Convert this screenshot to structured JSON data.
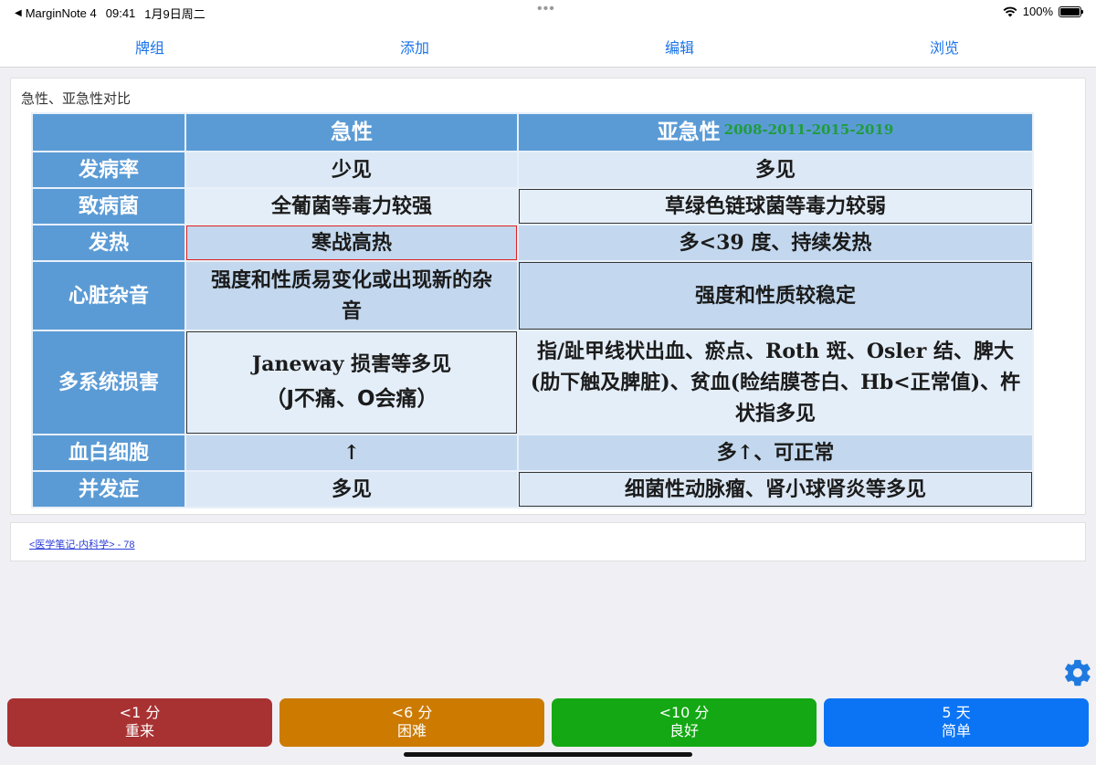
{
  "status_bar": {
    "back_app": "MarginNote 4",
    "time": "09:41",
    "date": "1月9日周二",
    "battery": "100%"
  },
  "nav": {
    "deck": "牌组",
    "add": "添加",
    "edit": "编辑",
    "browse": "浏览"
  },
  "card": {
    "title": "急性、亚急性对比",
    "table": {
      "col_acute": "急性",
      "col_subacute": "亚急性",
      "years": "2008-2011-2015-2019",
      "rows": [
        {
          "label": "发病率",
          "acute": "少见",
          "subacute": "多见"
        },
        {
          "label": "致病菌",
          "acute": "全葡菌等毒力较强",
          "subacute": "草绿色链球菌等毒力较弱"
        },
        {
          "label": "发热",
          "acute": "寒战高热",
          "subacute": "多<39 度、持续发热"
        },
        {
          "label": "心脏杂音",
          "acute": "强度和性质易变化或出现新的杂音",
          "subacute": "强度和性质较稳定"
        },
        {
          "label": "多系统损害",
          "acute": "Janeway 损害等多见",
          "acute_note": "（J不痛、O会痛）",
          "subacute": "指/趾甲线状出血、瘀点、Roth 斑、Osler 结、脾大(肋下触及脾脏)、贫血(睑结膜苍白、Hb<正常值)、杵状指多见"
        },
        {
          "label": "血白细胞",
          "acute": "↑",
          "subacute": "多↑、可正常"
        },
        {
          "label": "并发症",
          "acute": "多见",
          "subacute": "细菌性动脉瘤、肾小球肾炎等多见"
        }
      ]
    }
  },
  "source": {
    "link": "<医学笔记-内科学> - 78"
  },
  "answers": [
    {
      "time": "<1 分",
      "label": "重来",
      "color": "#a83232"
    },
    {
      "time": "<6 分",
      "label": "困难",
      "color": "#cc7a00"
    },
    {
      "time": "<10 分",
      "label": "良好",
      "color": "#14a814"
    },
    {
      "time": "5 天",
      "label": "简单",
      "color": "#0a74f5"
    }
  ],
  "icons": {
    "settings": "gear-icon",
    "wifi": "wifi-icon",
    "battery": "battery-icon"
  }
}
